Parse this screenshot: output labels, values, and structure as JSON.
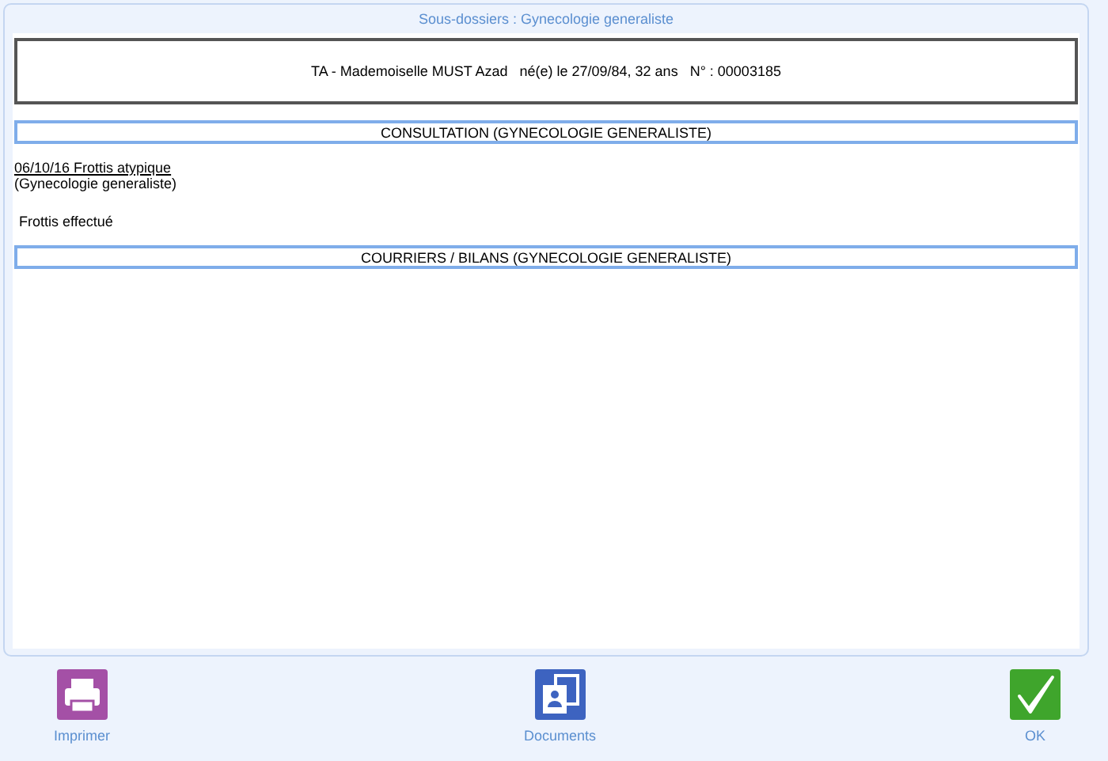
{
  "window": {
    "title": "Sous-dossiers : Gynecologie generaliste"
  },
  "patient": {
    "text": "TA - Mademoiselle MUST Azad   né(e) le 27/09/84, 32 ans   N° : 00003185"
  },
  "sections": [
    {
      "heading": "CONSULTATION (GYNECOLOGIE GENERALISTE)",
      "entries": [
        {
          "title": "06/10/16 Frottis atypique",
          "subtitle": "(Gynecologie generaliste)",
          "note": "Frottis effectué"
        }
      ]
    },
    {
      "heading": "COURRIERS / BILANS (GYNECOLOGIE GENERALISTE)"
    }
  ],
  "buttons": [
    {
      "kind": "print",
      "label": "Imprimer"
    },
    {
      "kind": "documents",
      "label": "Documents"
    },
    {
      "kind": "ok",
      "label": "OK"
    }
  ]
}
